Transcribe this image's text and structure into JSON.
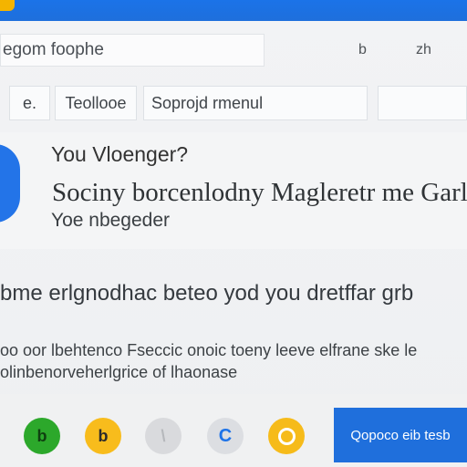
{
  "search": {
    "value": "egom foophe",
    "tool_a": "b",
    "tool_b": "zh"
  },
  "fields": {
    "short": "e.",
    "medium": "Teollooe",
    "long": "Soprojd rmenul",
    "blank": ""
  },
  "card": {
    "headline": "You Vloenger?",
    "subheadline": "Sociny borcenlodny Magleretr me Garlo",
    "small_headline": "Yoe nbegeder"
  },
  "content": {
    "body": "bme erlgnodhac beteo yod you dretffar grb",
    "detail_1": "oo oor lbehtenco Fseccic onoic toeny leeve elfrane ske le",
    "detail_2": "olinbenorveherlgrice of lhaonase"
  },
  "actions": {
    "green_label": "b",
    "yellow_label": "b",
    "gray_label": "\\",
    "blue_label": "C",
    "cta_label": "Qopoco eib tesb"
  },
  "colors": {
    "primary_blue": "#1f6fdc",
    "green": "#2ca82b",
    "yellow": "#f8bc1c",
    "gray": "#d9dadd"
  }
}
